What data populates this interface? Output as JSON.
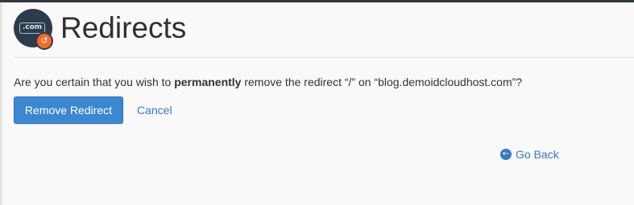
{
  "header": {
    "title": "Redirects",
    "icon_text": ".com",
    "icon_name": "redirects-dotcom-icon",
    "badge_icon_name": "redirect-arrow-icon"
  },
  "confirmation": {
    "prefix": "Are you certain that you wish to ",
    "emphasis": "permanently",
    "middle": " remove the redirect “/” on “blog.demoidcloudhost.com”?"
  },
  "actions": {
    "remove_label": "Remove Redirect",
    "cancel_label": "Cancel",
    "go_back_label": "Go Back",
    "go_back_icon_name": "circle-arrow-left-icon"
  },
  "colors": {
    "primary_button": "#3b87d0",
    "link": "#3a79c0",
    "badge": "#f26a29",
    "top_bar": "#2f3942"
  }
}
